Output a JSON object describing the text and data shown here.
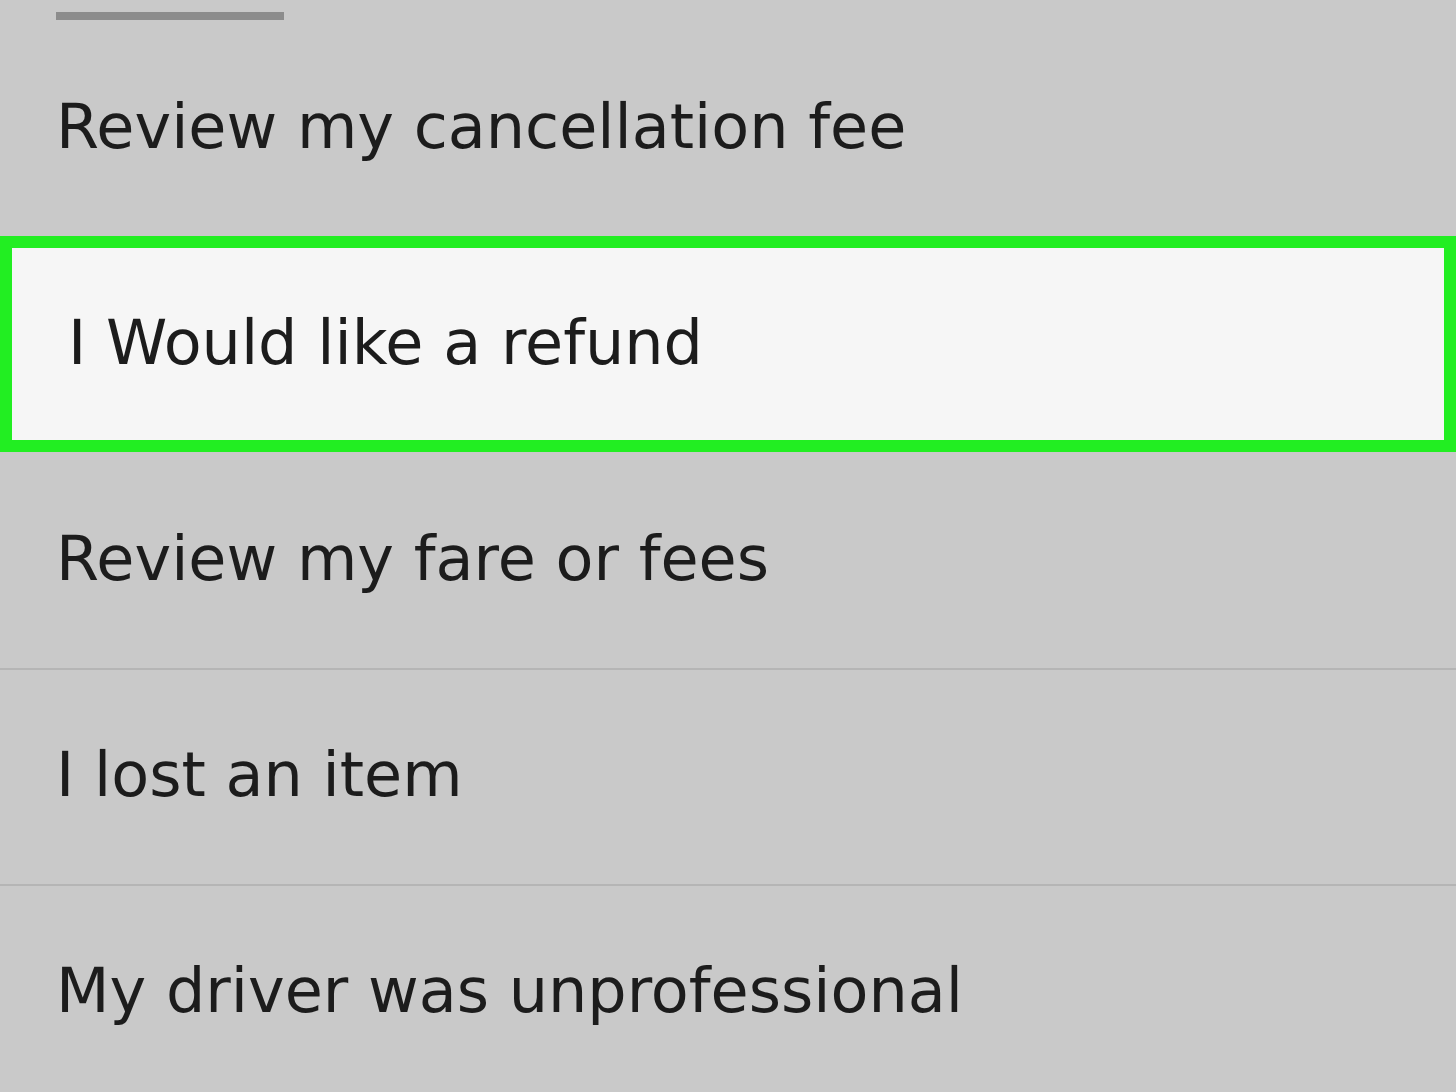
{
  "options": [
    {
      "label": "Review my cancellation fee",
      "selected": false
    },
    {
      "label": "I Would like a refund",
      "selected": true
    },
    {
      "label": "Review my fare or fees",
      "selected": false
    },
    {
      "label": "I lost an item",
      "selected": false
    },
    {
      "label": "My driver was unprofessional",
      "selected": false
    }
  ]
}
